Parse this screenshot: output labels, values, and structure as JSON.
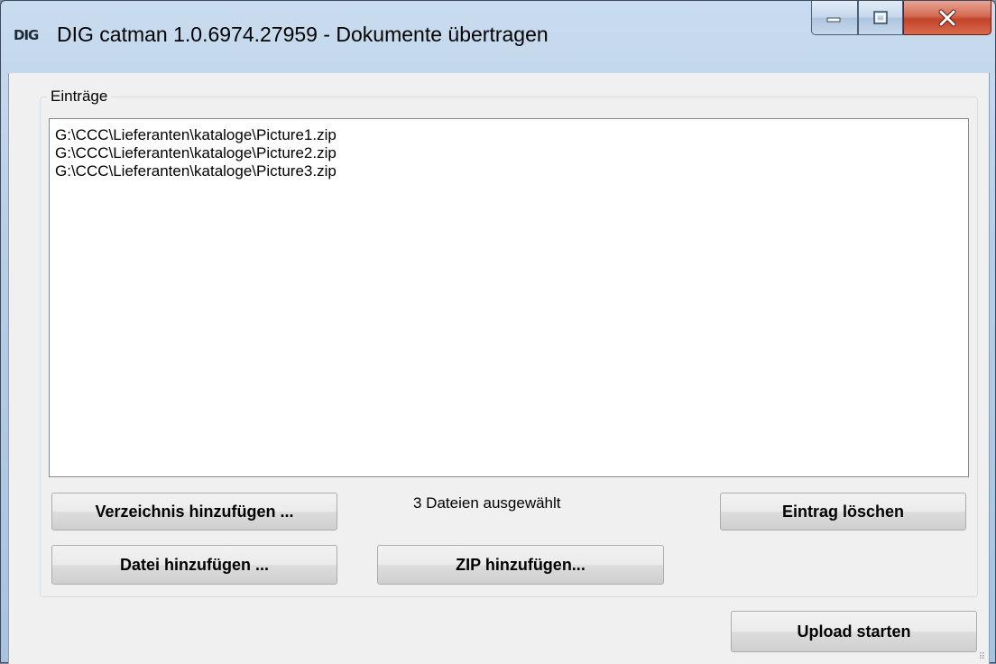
{
  "window": {
    "logo": "DIG",
    "title": "DIG catman 1.0.6974.27959 - Dokumente übertragen"
  },
  "group": {
    "label": "Einträge"
  },
  "list": {
    "items": [
      "G:\\CCC\\Lieferanten\\kataloge\\Picture1.zip",
      "G:\\CCC\\Lieferanten\\kataloge\\Picture2.zip",
      "G:\\CCC\\Lieferanten\\kataloge\\Picture3.zip"
    ]
  },
  "buttons": {
    "add_directory": "Verzeichnis hinzufügen ...",
    "add_file": "Datei hinzufügen ...",
    "add_zip": "ZIP hinzufügen...",
    "delete_entry": "Eintrag löschen",
    "start_upload": "Upload starten"
  },
  "status": {
    "selected_text": "3 Dateien ausgewählt"
  },
  "icons": [
    "minimize-icon",
    "maximize-icon",
    "close-icon",
    "resize-grip-icon"
  ],
  "colors": {
    "close_button": "#c2432a",
    "titlebar": "#b6cde6",
    "dialog_background": "#f0f0f0"
  }
}
